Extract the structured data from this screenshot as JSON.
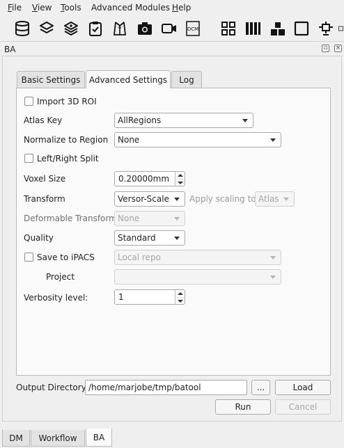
{
  "menu": [
    {
      "label": "File",
      "mnemonic": "F",
      "rest": "ile"
    },
    {
      "label": "View",
      "mnemonic": "V",
      "rest": "iew"
    },
    {
      "label": "Tools",
      "mnemonic": "T",
      "rest": "ools"
    },
    {
      "label": "Advanced Modules",
      "mnemonic": "",
      "rest": "Advanced Modules"
    },
    {
      "label": "Help",
      "mnemonic": "H",
      "rest": "elp"
    }
  ],
  "toolbar": {
    "icons": [
      "database-icon",
      "layers-icon",
      "stack-add-icon",
      "clipboard-check-icon",
      "tuxedo-icon",
      "camera-icon",
      "video-camera-icon",
      "dcm-icon",
      "grid-2x2-icon",
      "columns-icon",
      "layout-icon",
      "single-view-icon",
      "gimbal-icon"
    ],
    "dcm_label": "DCM"
  },
  "dock": {
    "title": "BA"
  },
  "tabs": [
    "Basic Settings",
    "Advanced Settings",
    "Log"
  ],
  "active_tab": "Advanced Settings",
  "form": {
    "import_3d_roi": {
      "label": "Import 3D ROI",
      "checked": false
    },
    "atlas_key": {
      "label": "Atlas Key",
      "value": "AllRegions"
    },
    "normalize_to_region": {
      "label": "Normalize to Region",
      "value": "None"
    },
    "left_right_split": {
      "label": "Left/Right Split",
      "checked": false
    },
    "voxel_size": {
      "label": "Voxel Size",
      "value": "0.20000mm"
    },
    "transform": {
      "label": "Transform",
      "value": "Versor-Scale"
    },
    "apply_scaling_to": {
      "label": "Apply scaling to:",
      "value": "Atlas"
    },
    "deformable_transform": {
      "label": "Deformable Transform",
      "value": "None"
    },
    "quality": {
      "label": "Quality",
      "value": "Standard"
    },
    "save_to_ipacs": {
      "label": "Save to iPACS",
      "checked": false,
      "value": "Local repo"
    },
    "project": {
      "label": "Project",
      "value": ""
    },
    "verbosity_level": {
      "label": "Verbosity level:",
      "value": "1"
    }
  },
  "output": {
    "label": "Output Directory",
    "value": "/home/marjobe/tmp/batool",
    "browse_label": "...",
    "load_label": "Load"
  },
  "actions": {
    "run_label": "Run",
    "cancel_label": "Cancel"
  },
  "bottom_tabs": [
    "DM",
    "Workflow",
    "BA"
  ],
  "active_bottom_tab": "BA"
}
